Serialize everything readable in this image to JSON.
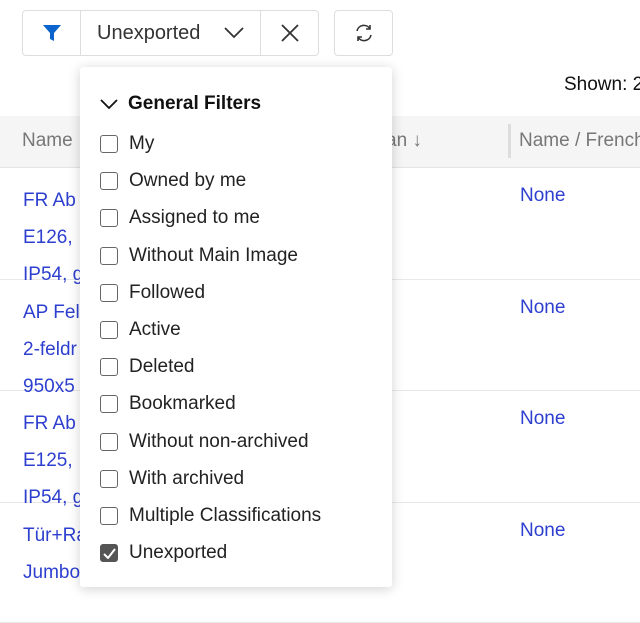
{
  "toolbar": {
    "filter_value": "Unexported",
    "accent": "#0b63ce"
  },
  "shown_label": "Shown: 2",
  "table": {
    "headers": [
      "Name",
      "an ↓",
      "Name / French"
    ],
    "rows": [
      {
        "name_lines": [
          "FR Ab",
          "E126,",
          "IP54, g"
        ],
        "french": "None"
      },
      {
        "name_lines": [
          "AP Fel",
          "2-feldr",
          "950x5"
        ],
        "french": "None"
      },
      {
        "name_lines": [
          "FR Ab",
          "E125,",
          "IP54, g"
        ],
        "french": "None"
      },
      {
        "name_lines": [
          "Tür+Ra",
          "Jumbo",
          ""
        ],
        "french": "None"
      }
    ]
  },
  "dropdown": {
    "section": "General Filters",
    "options": [
      {
        "label": "My",
        "checked": false
      },
      {
        "label": "Owned by me",
        "checked": false
      },
      {
        "label": "Assigned to me",
        "checked": false
      },
      {
        "label": "Without Main Image",
        "checked": false
      },
      {
        "label": "Followed",
        "checked": false
      },
      {
        "label": "Active",
        "checked": false
      },
      {
        "label": "Deleted",
        "checked": false
      },
      {
        "label": "Bookmarked",
        "checked": false
      },
      {
        "label": "Without non-archived",
        "checked": false
      },
      {
        "label": "With archived",
        "checked": false
      },
      {
        "label": "Multiple Classifications",
        "checked": false
      },
      {
        "label": "Unexported",
        "checked": true
      }
    ]
  }
}
